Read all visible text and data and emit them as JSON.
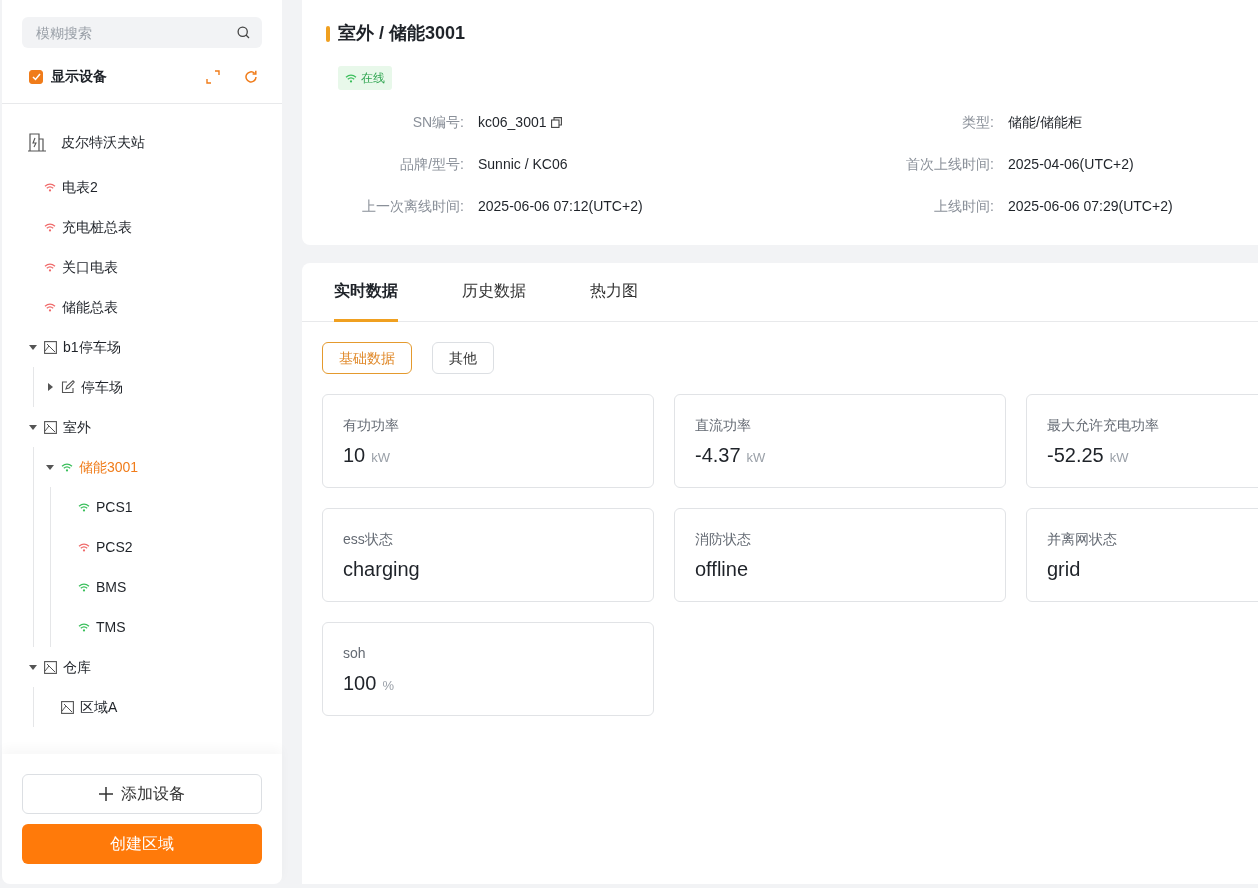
{
  "sidebar": {
    "search": {
      "placeholder": "模糊搜索"
    },
    "show_devices": {
      "label": "显示设备",
      "checked": true
    },
    "tree": [
      {
        "kind": "station",
        "label": "皮尔特沃夫站",
        "children": [
          {
            "kind": "device",
            "label": "电表2",
            "online": false,
            "selected": false
          },
          {
            "kind": "device",
            "label": "充电桩总表",
            "online": false,
            "selected": false
          },
          {
            "kind": "device",
            "label": "关口电表",
            "online": false,
            "selected": false
          },
          {
            "kind": "device",
            "label": "储能总表",
            "online": false,
            "selected": false
          },
          {
            "kind": "area",
            "label": "b1停车场",
            "expanded": true,
            "children": [
              {
                "kind": "zone",
                "label": "停车场",
                "expanded": false
              }
            ]
          },
          {
            "kind": "area",
            "label": "室外",
            "expanded": true,
            "children": [
              {
                "kind": "device",
                "label": "储能3001",
                "online": true,
                "selected": true,
                "expanded": true,
                "children": [
                  {
                    "kind": "device",
                    "label": "PCS1",
                    "online": true,
                    "selected": false
                  },
                  {
                    "kind": "device",
                    "label": "PCS2",
                    "online": false,
                    "selected": false
                  },
                  {
                    "kind": "device",
                    "label": "BMS",
                    "online": true,
                    "selected": false
                  },
                  {
                    "kind": "device",
                    "label": "TMS",
                    "online": true,
                    "selected": false
                  }
                ]
              }
            ]
          },
          {
            "kind": "area",
            "label": "仓库",
            "expanded": true,
            "children": [
              {
                "kind": "leaf_area",
                "label": "区域A"
              }
            ]
          }
        ]
      }
    ],
    "buttons": [
      {
        "kind": "outline",
        "label": "添加设备"
      },
      {
        "kind": "primary",
        "label": "创建区域"
      }
    ]
  },
  "header": {
    "title": "室外 / 储能3001",
    "status": {
      "label": "在线",
      "online": true
    },
    "fields": [
      {
        "label": "SN编号:",
        "value": "kc06_3001",
        "copyable": true
      },
      {
        "label": "类型:",
        "value": "储能/储能柜"
      },
      {
        "label": "品牌/型号:",
        "value": "Sunnic / KC06"
      },
      {
        "label": "首次上线时间:",
        "value": "2025-04-06(UTC+2)"
      },
      {
        "label": "上一次离线时间:",
        "value": "2025-06-06 07:12(UTC+2)"
      },
      {
        "label": "上线时间:",
        "value": "2025-06-06 07:29(UTC+2)"
      }
    ]
  },
  "tabs": [
    {
      "label": "实时数据",
      "selected": true
    },
    {
      "label": "历史数据",
      "selected": false
    },
    {
      "label": "热力图",
      "selected": false
    }
  ],
  "filters": [
    {
      "label": "基础数据",
      "selected": true
    },
    {
      "label": "其他",
      "selected": false
    }
  ],
  "metrics": [
    {
      "label": "有功功率",
      "value": "10",
      "unit": "kW"
    },
    {
      "label": "直流功率",
      "value": "-4.37",
      "unit": "kW"
    },
    {
      "label": "最大允许充电功率",
      "value": "-52.25",
      "unit": "kW"
    },
    {
      "label": "ess状态",
      "value": "charging"
    },
    {
      "label": "消防状态",
      "value": "offline"
    },
    {
      "label": "并离网状态",
      "value": "grid"
    },
    {
      "label": "soh",
      "value": "100",
      "unit": "%"
    }
  ]
}
